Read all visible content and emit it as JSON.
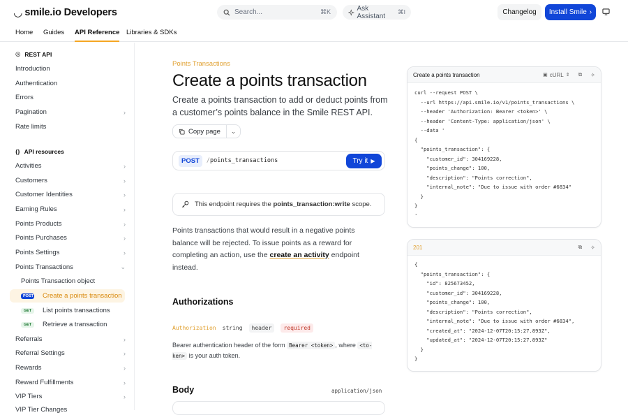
{
  "header": {
    "logo": "smile.io Developers",
    "search_placeholder": "Search...",
    "search_kbd": "⌘K",
    "ask_label": "Ask Assistant",
    "ask_kbd": "⌘I",
    "changelog": "Changelog",
    "install": "Install Smile"
  },
  "tabs": [
    "Home",
    "Guides",
    "API Reference",
    "Libraries & SDKs"
  ],
  "sidebar": {
    "rest_api": "REST API",
    "rest_items": [
      "Introduction",
      "Authentication",
      "Errors",
      "Pagination",
      "Rate limits"
    ],
    "resources": "API resources",
    "resource_items": [
      "Activities",
      "Customers",
      "Customer Identities",
      "Earning Rules",
      "Points Products",
      "Points Purchases",
      "Points Settings",
      "Points Transactions"
    ],
    "pt_object": "Points Transaction object",
    "pt_children": [
      {
        "method": "POST",
        "label": "Create a points transaction"
      },
      {
        "method": "GET",
        "label": "List points transactions"
      },
      {
        "method": "GET",
        "label": "Retrieve a transaction"
      }
    ],
    "after_items": [
      "Referrals",
      "Referral Settings",
      "Rewards",
      "Reward Fulfillments",
      "VIP Tiers",
      "VIP Tier Changes"
    ]
  },
  "main": {
    "eyebrow": "Points Transactions",
    "title": "Create a points transaction",
    "lead": "Create a points transaction to add or deduct points from a customer’s points balance in the Smile REST API.",
    "copy_page": "Copy page",
    "method": "POST",
    "path_sep": "/",
    "path": "points_transactions",
    "try_it": "Try it",
    "note_prefix": "This endpoint requires the ",
    "note_scope": "points_transaction:write",
    "note_suffix": " scope.",
    "para_1": "Points transactions that would result in a negative points balance will be rejected. To issue points as a reward for completing an action, use the ",
    "para_link": "create an activity",
    "para_2": " endpoint instead.",
    "auth_heading": "Authorizations",
    "auth_name": "Authorization",
    "auth_type": "string",
    "auth_loc": "header",
    "auth_required": "required",
    "auth_desc_1": "Bearer authentication header of the form ",
    "auth_code_1": "Bearer <token>",
    "auth_desc_2": ", where ",
    "auth_code_2": "<to-ken>",
    "auth_desc_3": " is your auth token.",
    "body_heading": "Body",
    "content_type": "application/json"
  },
  "request_panel": {
    "title": "Create a points transaction",
    "lang": "cURL",
    "code": "curl --request POST \\\n  --url https://api.smile.io/v1/points_transactions \\\n  --header 'Authorization: Bearer <token>' \\\n  --header 'Content-Type: application/json' \\\n  --data '\n{\n  \"points_transaction\": {\n    \"customer_id\": 304169228,\n    \"points_change\": 100,\n    \"description\": \"Points correction\",\n    \"internal_note\": \"Due to issue with order #6834\"\n  }\n}\n'"
  },
  "response_panel": {
    "status": "201",
    "code": "{\n  \"points_transaction\": {\n    \"id\": 825673452,\n    \"customer_id\": 304169228,\n    \"points_change\": 100,\n    \"description\": \"Points correction\",\n    \"internal_note\": \"Due to issue with order #6834\",\n    \"created_at\": \"2024-12-07T20:15:27.893Z\",\n    \"updated_at\": \"2024-12-07T20:15:27.893Z\"\n  }\n}"
  },
  "colors": {
    "accent": "#1146d8",
    "highlight": "#e0a030"
  }
}
